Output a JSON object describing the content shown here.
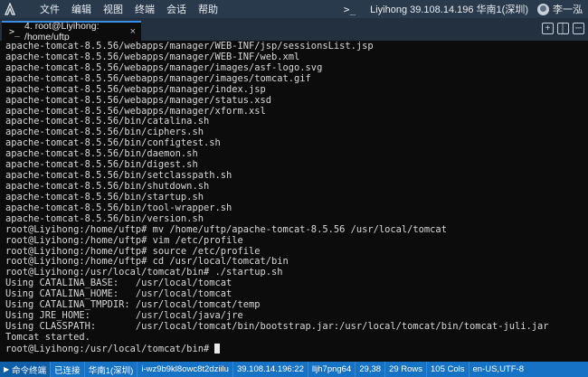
{
  "app": {
    "menu": [
      "文件",
      "编辑",
      "视图",
      "终端",
      "会话",
      "帮助"
    ],
    "host": "Liyihong 39.108.14.196 华南1(深圳)",
    "user": "李一泓"
  },
  "tab": {
    "label": "4. root@Liyihong: /home/uftp"
  },
  "terminal": {
    "lines": [
      "apache-tomcat-8.5.56/webapps/manager/WEB-INF/jsp/sessionsList.jsp",
      "apache-tomcat-8.5.56/webapps/manager/WEB-INF/web.xml",
      "apache-tomcat-8.5.56/webapps/manager/images/asf-logo.svg",
      "apache-tomcat-8.5.56/webapps/manager/images/tomcat.gif",
      "apache-tomcat-8.5.56/webapps/manager/index.jsp",
      "apache-tomcat-8.5.56/webapps/manager/status.xsd",
      "apache-tomcat-8.5.56/webapps/manager/xform.xsl",
      "apache-tomcat-8.5.56/bin/catalina.sh",
      "apache-tomcat-8.5.56/bin/ciphers.sh",
      "apache-tomcat-8.5.56/bin/configtest.sh",
      "apache-tomcat-8.5.56/bin/daemon.sh",
      "apache-tomcat-8.5.56/bin/digest.sh",
      "apache-tomcat-8.5.56/bin/setclasspath.sh",
      "apache-tomcat-8.5.56/bin/shutdown.sh",
      "apache-tomcat-8.5.56/bin/startup.sh",
      "apache-tomcat-8.5.56/bin/tool-wrapper.sh",
      "apache-tomcat-8.5.56/bin/version.sh",
      "root@Liyihong:/home/uftp# mv /home/uftp/apache-tomcat-8.5.56 /usr/local/tomcat",
      "root@Liyihong:/home/uftp# vim /etc/profile",
      "root@Liyihong:/home/uftp# source /etc/profile",
      "root@Liyihong:/home/uftp# cd /usr/local/tomcat/bin",
      "root@Liyihong:/usr/local/tomcat/bin# ./startup.sh",
      "Using CATALINA_BASE:   /usr/local/tomcat",
      "Using CATALINA_HOME:   /usr/local/tomcat",
      "Using CATALINA_TMPDIR: /usr/local/tomcat/temp",
      "Using JRE_HOME:        /usr/local/java/jre",
      "Using CLASSPATH:       /usr/local/tomcat/bin/bootstrap.jar:/usr/local/tomcat/bin/tomcat-juli.jar",
      "Tomcat started."
    ],
    "prompt": "root@Liyihong:/usr/local/tomcat/bin# "
  },
  "status": {
    "mode": "命令终端",
    "connection": "已连接",
    "region": "华南1(深圳)",
    "instance": "i-wz9b9kl8owc8t2dziilu",
    "ip": "39.108.14.196:22",
    "terminal_type": "lljh7png64",
    "cursor_pos": "29,38",
    "rows": "29 Rows",
    "cols": "105 Cols",
    "extra": "en-US,UTF-8"
  }
}
